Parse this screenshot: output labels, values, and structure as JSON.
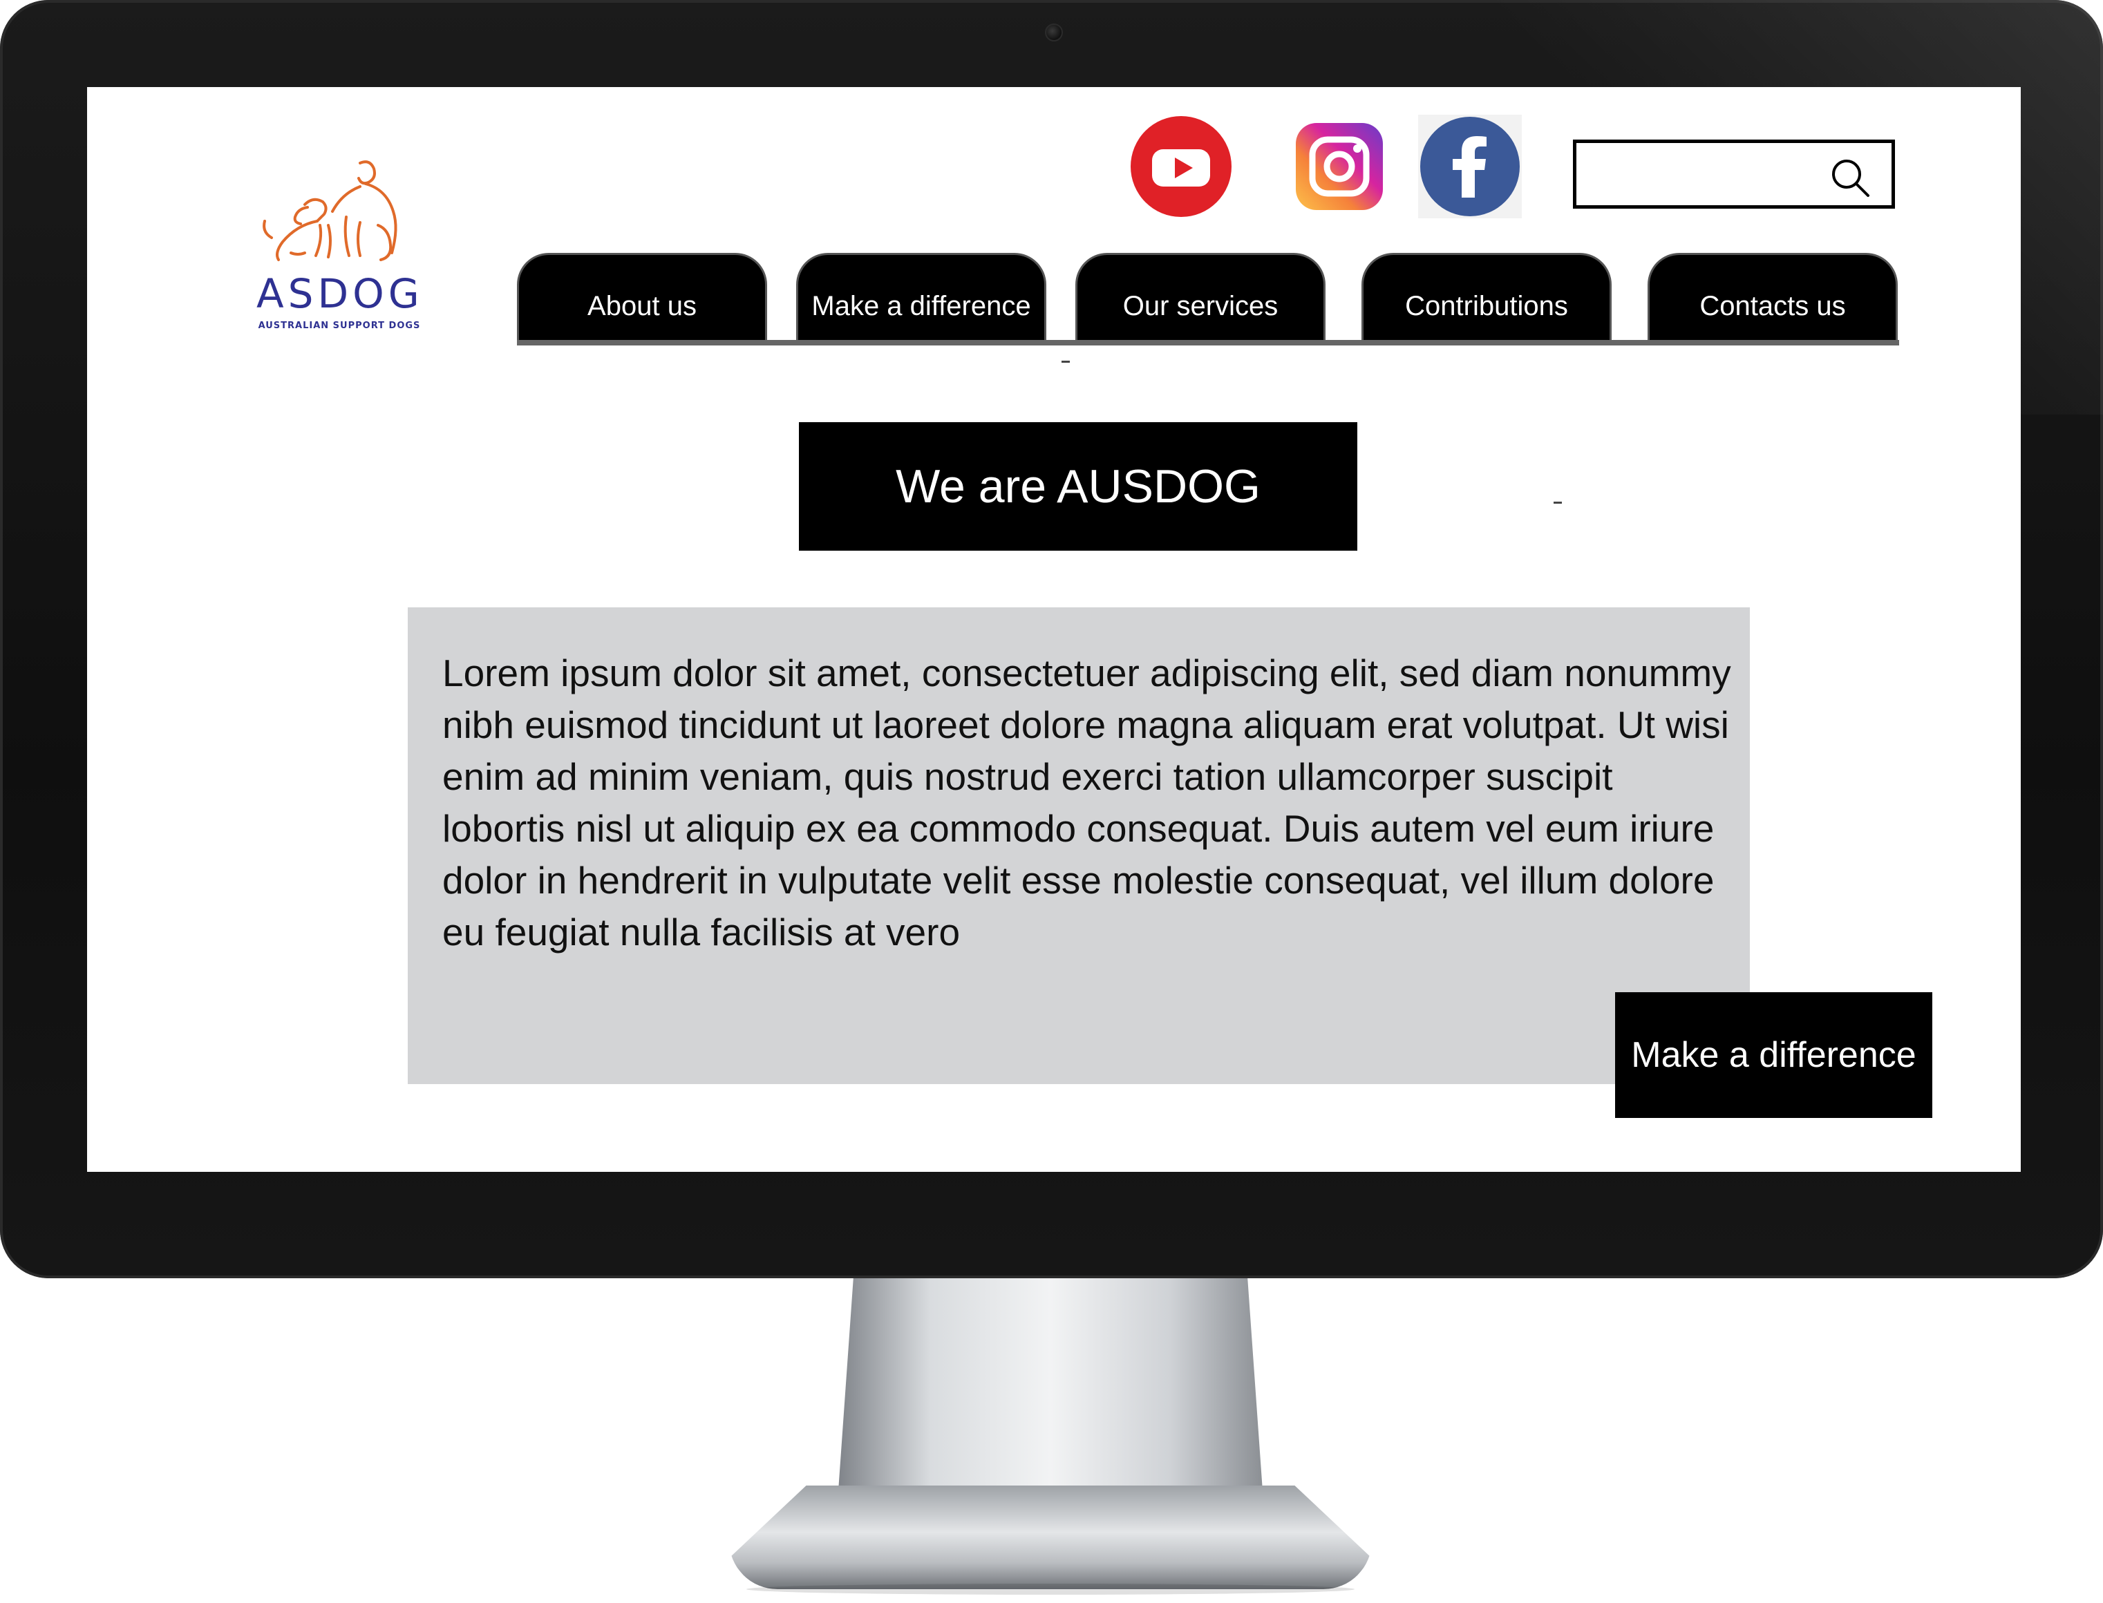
{
  "logo": {
    "text": "ASDOG",
    "tagline": "AUSTRALIAN SUPPORT DOGS",
    "colors": {
      "mark": "#e06a2a",
      "text": "#2e3192"
    }
  },
  "social": [
    {
      "name": "YouTube",
      "icon": "youtube-icon",
      "color": "#e02127"
    },
    {
      "name": "Instagram",
      "icon": "instagram-icon",
      "color": "#d6249f"
    },
    {
      "name": "Facebook",
      "icon": "facebook-icon",
      "color": "#3b5998"
    }
  ],
  "search": {
    "value": "",
    "placeholder": "",
    "icon": "search-icon"
  },
  "nav": {
    "items": [
      {
        "label": "About us"
      },
      {
        "label": "Make a difference"
      },
      {
        "label": "Our services"
      },
      {
        "label": "Contributions"
      },
      {
        "label": "Contacts us"
      }
    ]
  },
  "hero": {
    "title": "We are AUSDOG"
  },
  "content": {
    "body": "Lorem ipsum dolor sit amet, consectetuer adipiscing elit, sed diam nonummy nibh euismod tincidunt ut laoreet dolore magna aliquam erat volutpat. Ut wisi enim ad minim veniam, quis nostrud exerci tation ullamcorper suscipit lobortis nisl ut aliquip ex ea commodo consequat. Duis autem vel eum iriure dolor in hendrerit in vulputate velit esse molestie consequat, vel illum dolore eu feugiat nulla facilisis at vero"
  },
  "cta": {
    "label": "Make a difference"
  },
  "theme": {
    "nav_bg": "#000000",
    "panel_bg": "#d3d4d6",
    "text": "#111111"
  }
}
